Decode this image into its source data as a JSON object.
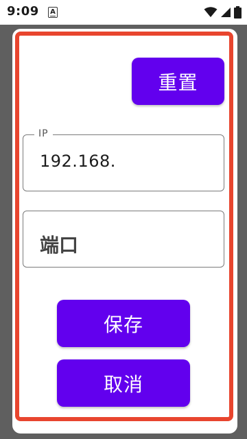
{
  "status_bar": {
    "time": "9:09",
    "notification_glyph": "A",
    "icons": [
      "wifi-icon",
      "signal-icon",
      "battery-icon"
    ]
  },
  "dialog": {
    "reset_label": "重置",
    "ip_field": {
      "label": "IP",
      "value": "192.168."
    },
    "port_field": {
      "placeholder": "端口",
      "value": ""
    },
    "save_label": "保存",
    "cancel_label": "取消"
  },
  "colors": {
    "accent": "#6200ee",
    "frame_highlight": "#e8452e",
    "scrim": "#5f5f5f"
  }
}
